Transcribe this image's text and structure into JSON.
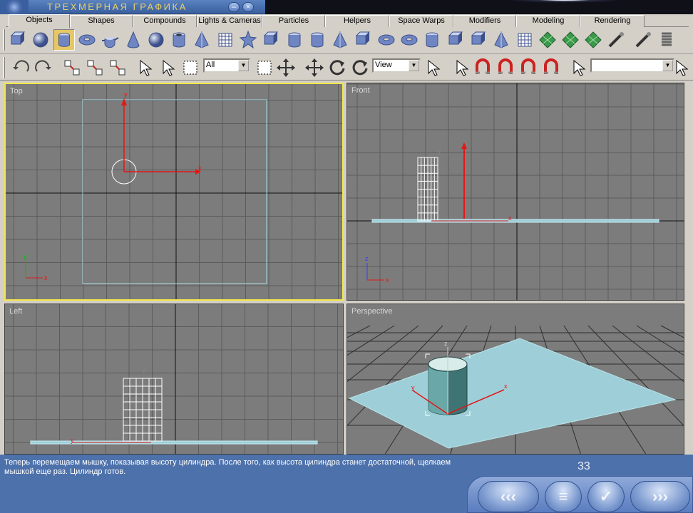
{
  "window": {
    "title": "ТРЕХМЕРНАЯ ГРАФИКА",
    "minimize_icon": "minimize-icon",
    "close_icon": "close-icon",
    "min_glyph": "–",
    "close_glyph": "×"
  },
  "tabs": [
    {
      "label": "Objects",
      "active": true
    },
    {
      "label": "Shapes"
    },
    {
      "label": "Compounds"
    },
    {
      "label": "Lights & Cameras"
    },
    {
      "label": "Particles"
    },
    {
      "label": "Helpers"
    },
    {
      "label": "Space Warps"
    },
    {
      "label": "Modifiers"
    },
    {
      "label": "Modeling"
    },
    {
      "label": "Rendering"
    }
  ],
  "toolbar": {
    "primitives": [
      "box-icon",
      "sphere-icon",
      "cylinder-icon",
      "torus-icon",
      "teapot-icon",
      "cone-icon",
      "geosphere-icon",
      "tube-icon",
      "pyramid-icon",
      "plane-grid-icon",
      "star-icon",
      "chamferbox-icon",
      "capsule-icon",
      "oiltank-icon",
      "hedra-icon",
      "gengon-icon",
      "torusknot-icon",
      "ringwave-icon",
      "spindle-icon",
      "l-ext-icon",
      "c-ext-icon",
      "prism-icon",
      "patch-grid-icon",
      "tri-patch-icon",
      "nurbs-surface-icon",
      "nurbs-surface-cv-icon",
      "bone-icon",
      "camera-icon",
      "spring-icon"
    ],
    "pressed_tool": "cylinder-icon",
    "selection_filter": "All",
    "coord_system": "View",
    "named_selection": "",
    "tools2": [
      "undo-icon",
      "redo-icon",
      "link-icon",
      "unlink-icon",
      "bind-spacewarp-icon",
      "select-icon",
      "select-by-name-icon",
      "rect-region-icon",
      "window-crossing-icon",
      "move-gizmo-icon",
      "move-icon",
      "rotate-icon",
      "scale-icon",
      "pivot-icon",
      "mirror-icon",
      "snap3-icon",
      "angle-snap-icon",
      "percent-snap-icon",
      "spinner-snap-icon",
      "named-selection-icon",
      "mirror2-icon"
    ]
  },
  "viewports": {
    "top": {
      "label": "Top"
    },
    "front": {
      "label": "Front"
    },
    "left": {
      "label": "Left"
    },
    "perspective": {
      "label": "Perspective"
    }
  },
  "axes": {
    "x": "x",
    "y": "y",
    "z": "z"
  },
  "bottom": {
    "caption": "Теперь перемещаем мышку, показывая высоту цилиндра. После того, как высота цилиндра станет достаточной, щелкаем мышкой еще раз. Цилиндр готов.",
    "page_number": "33",
    "nav": {
      "back": "‹‹‹",
      "menu": "≡",
      "check": "✓",
      "forward": "›››"
    }
  },
  "colors": {
    "active_viewport": "#f2e64a",
    "plane": "#9ecfd8",
    "axis": "#e01818",
    "grid": "#5a5a5a"
  }
}
